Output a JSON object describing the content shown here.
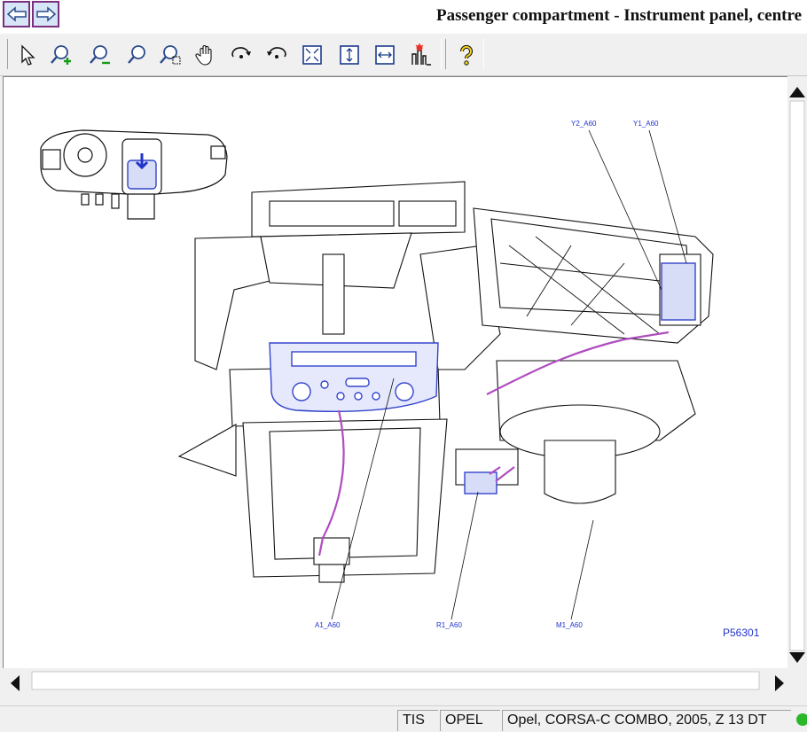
{
  "title": "Passenger compartment - Instrument panel, centre",
  "nav": {
    "back": "back-arrow",
    "forward": "forward-arrow"
  },
  "toolbar": {
    "tools": [
      "pointer",
      "zoom-in",
      "zoom-out",
      "zoom",
      "zoom-window",
      "pan-hand",
      "rotate-right",
      "rotate-left",
      "fit-all",
      "fit-height",
      "fit-width",
      "highlight",
      "help"
    ]
  },
  "diagram": {
    "labels": {
      "y2": "Y2_A60",
      "y1": "Y1_A60",
      "a1": "A1_A60",
      "r1": "R1_A60",
      "m1": "M1_A60"
    },
    "picture_code": "P56301"
  },
  "status": {
    "app": "TIS",
    "make": "OPEL",
    "vehicle": "Opel, CORSA-C COMBO, 2005, Z 13 DT"
  },
  "colors": {
    "accent": "#7b2f7f",
    "label": "#2233cc",
    "harness": "#b04cc0",
    "highlight": "#3344cc"
  }
}
